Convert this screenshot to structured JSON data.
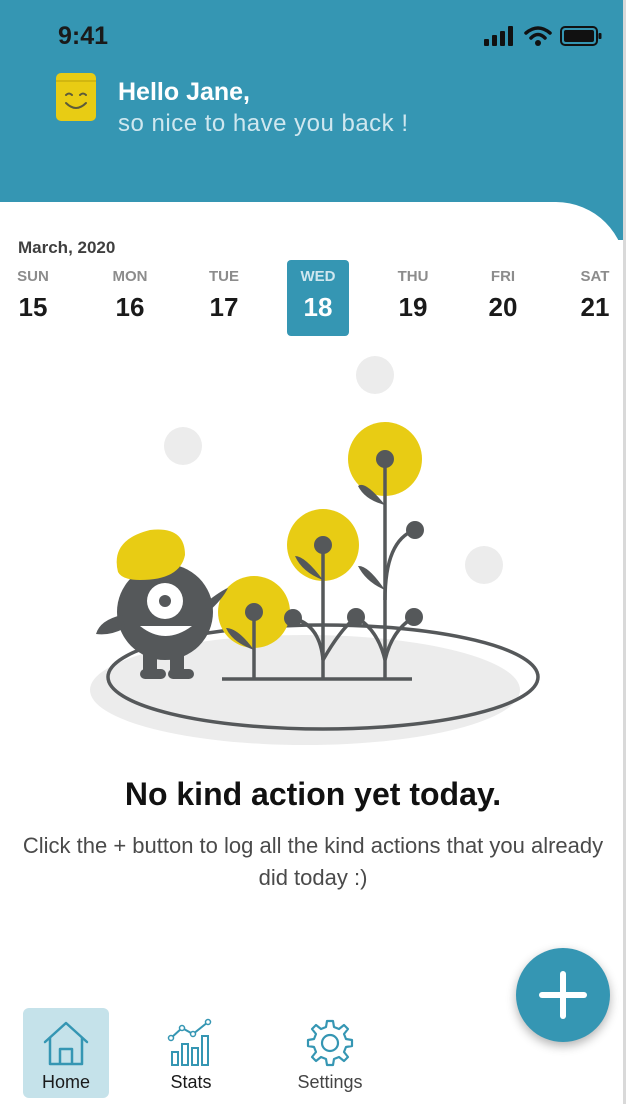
{
  "status_bar": {
    "time": "9:41"
  },
  "greeting": {
    "line1": "Hello Jane,",
    "line2": "so nice to have you back !"
  },
  "calendar": {
    "month": "March, 2020",
    "days": [
      {
        "name": "SUN",
        "num": "15"
      },
      {
        "name": "MON",
        "num": "16"
      },
      {
        "name": "TUE",
        "num": "17"
      },
      {
        "name": "WED",
        "num": "18",
        "selected": true
      },
      {
        "name": "THU",
        "num": "19"
      },
      {
        "name": "FRI",
        "num": "20"
      },
      {
        "name": "SAT",
        "num": "21"
      }
    ]
  },
  "empty_state": {
    "title": "No kind action yet today.",
    "description": "Click the + button to log all the kind actions that you already did today :)"
  },
  "fab": {
    "icon": "plus-icon"
  },
  "bottom_nav": {
    "items": [
      {
        "label": "Home",
        "icon": "home-icon",
        "active": true
      },
      {
        "label": "Stats",
        "icon": "stats-icon"
      },
      {
        "label": "Settings",
        "icon": "gear-icon"
      }
    ]
  },
  "colors": {
    "primary": "#3596b3",
    "accent_yellow": "#e8cc14",
    "dark_gray": "#55585a"
  }
}
